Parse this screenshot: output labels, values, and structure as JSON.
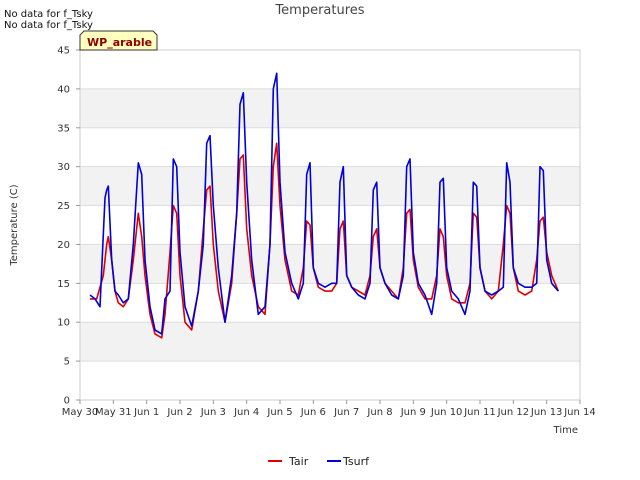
{
  "notes": [
    "No data for f_Tsky",
    "No data for f_Tsky"
  ],
  "badge": "WP_arable",
  "chart_data": {
    "type": "line",
    "title": "Temperatures",
    "xlabel": "Time",
    "ylabel": "Temperature (C)",
    "ylim": [
      0,
      45
    ],
    "yticks": [
      0,
      5,
      10,
      15,
      20,
      25,
      30,
      35,
      40,
      45
    ],
    "xlim": [
      0,
      15
    ],
    "xticks": [
      {
        "day": 0,
        "label": "May 30"
      },
      {
        "day": 1,
        "label": "May 31"
      },
      {
        "day": 2,
        "label": "Jun 1"
      },
      {
        "day": 3,
        "label": "Jun 2"
      },
      {
        "day": 4,
        "label": "Jun 3"
      },
      {
        "day": 5,
        "label": "Jun 4"
      },
      {
        "day": 6,
        "label": "Jun 5"
      },
      {
        "day": 7,
        "label": "Jun 6"
      },
      {
        "day": 8,
        "label": "Jun 7"
      },
      {
        "day": 9,
        "label": "Jun 8"
      },
      {
        "day": 10,
        "label": "Jun 9"
      },
      {
        "day": 11,
        "label": "Jun 10"
      },
      {
        "day": 12,
        "label": "Jun 11"
      },
      {
        "day": 13,
        "label": "Jun 12"
      },
      {
        "day": 14,
        "label": "Jun 13"
      },
      {
        "day": 15,
        "label": "Jun 14"
      }
    ],
    "grid": true,
    "legend_position": "bottom-center",
    "series": [
      {
        "name": "Tair",
        "color": "#dd0000",
        "x": [
          0.3,
          0.5,
          0.7,
          0.8,
          0.85,
          0.95,
          1.05,
          1.15,
          1.3,
          1.45,
          1.6,
          1.75,
          1.85,
          1.95,
          2.1,
          2.25,
          2.45,
          2.55,
          2.7,
          2.8,
          2.9,
          3.0,
          3.15,
          3.35,
          3.55,
          3.7,
          3.8,
          3.9,
          4.0,
          4.15,
          4.35,
          4.55,
          4.7,
          4.8,
          4.9,
          5.0,
          5.15,
          5.35,
          5.55,
          5.7,
          5.8,
          5.9,
          6.0,
          6.15,
          6.35,
          6.55,
          6.7,
          6.8,
          6.9,
          7.0,
          7.15,
          7.35,
          7.55,
          7.7,
          7.8,
          7.9,
          8.0,
          8.15,
          8.35,
          8.55,
          8.7,
          8.8,
          8.9,
          9.0,
          9.15,
          9.35,
          9.55,
          9.7,
          9.8,
          9.9,
          10.0,
          10.15,
          10.35,
          10.55,
          10.7,
          10.8,
          10.9,
          11.0,
          11.15,
          11.35,
          11.55,
          11.7,
          11.8,
          11.9,
          12.0,
          12.15,
          12.35,
          12.55,
          12.7,
          12.8,
          12.9,
          13.0,
          13.15,
          13.35,
          13.55,
          13.7,
          13.8,
          13.9,
          14.0,
          14.15,
          14.35
        ],
        "y": [
          13.0,
          13.0,
          16.0,
          20.0,
          21.0,
          18.0,
          14.0,
          12.5,
          12.0,
          13.0,
          18.0,
          24.0,
          21.0,
          16.0,
          11.0,
          8.5,
          8.0,
          11.0,
          19.0,
          25.0,
          24.0,
          16.0,
          10.0,
          9.0,
          14.0,
          22.0,
          27.0,
          27.5,
          20.0,
          14.0,
          10.0,
          15.0,
          24.0,
          31.0,
          31.5,
          22.0,
          16.0,
          12.0,
          11.0,
          20.0,
          30.0,
          33.0,
          25.0,
          18.0,
          14.0,
          13.5,
          17.0,
          23.0,
          22.5,
          17.0,
          14.5,
          14.0,
          14.0,
          15.0,
          22.0,
          23.0,
          16.0,
          14.5,
          14.0,
          13.5,
          16.0,
          21.0,
          22.0,
          17.0,
          15.0,
          14.0,
          13.0,
          17.0,
          24.0,
          24.5,
          18.0,
          14.5,
          13.0,
          13.0,
          16.0,
          22.0,
          21.0,
          16.0,
          13.0,
          12.5,
          12.5,
          15.0,
          24.0,
          23.5,
          17.0,
          14.0,
          13.0,
          14.0,
          20.0,
          25.0,
          24.0,
          17.0,
          14.0,
          13.5,
          14.0,
          18.0,
          23.0,
          23.5,
          19.0,
          16.0,
          14.0
        ]
      },
      {
        "name": "Tsurf",
        "color": "#0000dd",
        "x": [
          0.3,
          0.45,
          0.6,
          0.75,
          0.8,
          0.85,
          0.95,
          1.0,
          1.05,
          1.15,
          1.3,
          1.45,
          1.6,
          1.75,
          1.85,
          1.95,
          2.1,
          2.25,
          2.45,
          2.55,
          2.7,
          2.8,
          2.9,
          3.0,
          3.15,
          3.35,
          3.55,
          3.7,
          3.8,
          3.9,
          4.0,
          4.15,
          4.35,
          4.55,
          4.7,
          4.8,
          4.9,
          5.0,
          5.15,
          5.35,
          5.55,
          5.7,
          5.8,
          5.9,
          6.0,
          6.15,
          6.35,
          6.55,
          6.7,
          6.8,
          6.9,
          7.0,
          7.15,
          7.35,
          7.55,
          7.7,
          7.8,
          7.9,
          8.0,
          8.15,
          8.35,
          8.55,
          8.7,
          8.8,
          8.9,
          9.0,
          9.15,
          9.35,
          9.55,
          9.7,
          9.8,
          9.9,
          10.0,
          10.15,
          10.35,
          10.55,
          10.7,
          10.8,
          10.9,
          11.0,
          11.15,
          11.35,
          11.55,
          11.7,
          11.8,
          11.9,
          12.0,
          12.15,
          12.35,
          12.55,
          12.7,
          12.8,
          12.9,
          13.0,
          13.15,
          13.35,
          13.55,
          13.7,
          13.8,
          13.9,
          14.0,
          14.15,
          14.35
        ],
        "y": [
          13.5,
          13.0,
          12.0,
          26.0,
          27.0,
          27.5,
          18.0,
          16.0,
          14.0,
          13.5,
          12.5,
          13.0,
          20.0,
          30.5,
          29.0,
          18.0,
          12.0,
          9.0,
          8.5,
          13.0,
          14.0,
          31.0,
          30.0,
          19.0,
          12.0,
          9.5,
          14.0,
          20.0,
          33.0,
          34.0,
          25.0,
          17.0,
          10.0,
          16.0,
          24.0,
          38.0,
          39.5,
          28.0,
          18.0,
          11.0,
          12.0,
          20.0,
          40.0,
          42.0,
          28.0,
          19.0,
          15.0,
          13.0,
          15.0,
          29.0,
          30.5,
          17.0,
          15.0,
          14.5,
          15.0,
          15.0,
          28.0,
          30.0,
          16.0,
          14.5,
          13.5,
          13.0,
          15.0,
          27.0,
          28.0,
          17.0,
          15.0,
          13.5,
          13.0,
          16.0,
          30.0,
          31.0,
          19.0,
          15.0,
          13.5,
          11.0,
          15.0,
          28.0,
          28.5,
          17.0,
          14.0,
          13.0,
          11.0,
          14.0,
          28.0,
          27.5,
          17.0,
          14.0,
          13.5,
          14.0,
          14.5,
          30.5,
          28.0,
          17.0,
          15.0,
          14.5,
          14.5,
          15.0,
          30.0,
          29.5,
          18.0,
          15.0,
          14.0
        ]
      }
    ]
  }
}
